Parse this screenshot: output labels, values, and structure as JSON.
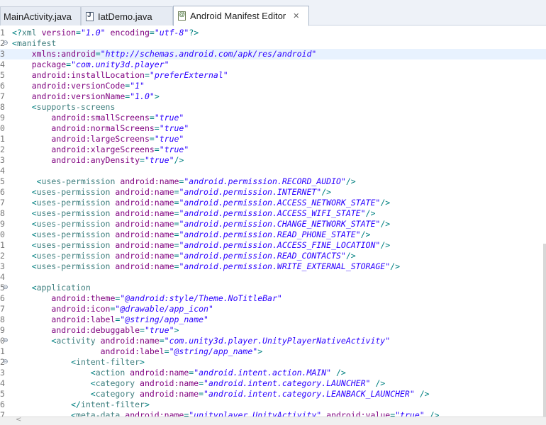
{
  "tabs": [
    {
      "label": "MainActivity.java",
      "icon": "java-file-icon",
      "active": false
    },
    {
      "label": "IatDemo.java",
      "icon": "java-file-icon",
      "active": false
    },
    {
      "label": "Android Manifest Editor",
      "icon": "xml-file-icon",
      "active": true
    }
  ],
  "editor": {
    "highlighted_line": 3,
    "lines": [
      {
        "num": "1",
        "fold": "",
        "segs": [
          [
            "punct",
            "<?"
          ],
          [
            "tag",
            "xml "
          ],
          [
            "attr",
            "version"
          ],
          [
            "punct",
            "="
          ],
          [
            "val",
            "\"1.0\""
          ],
          [
            "punct",
            " "
          ],
          [
            "attr",
            "encoding"
          ],
          [
            "punct",
            "="
          ],
          [
            "val",
            "\"utf-8\""
          ],
          [
            "punct",
            "?>"
          ]
        ]
      },
      {
        "num": "2",
        "fold": "⊖",
        "segs": [
          [
            "punct",
            "<"
          ],
          [
            "tag",
            "manifest"
          ]
        ]
      },
      {
        "num": "3",
        "fold": "",
        "segs": [
          [
            "punct",
            "    "
          ],
          [
            "attr",
            "xmlns:android"
          ],
          [
            "punct",
            "="
          ],
          [
            "val",
            "\"http://schemas.android.com/apk/res/android\""
          ]
        ]
      },
      {
        "num": "4",
        "fold": "",
        "segs": [
          [
            "punct",
            "    "
          ],
          [
            "attr",
            "package"
          ],
          [
            "punct",
            "="
          ],
          [
            "val",
            "\"com.unity3d.player\""
          ]
        ]
      },
      {
        "num": "5",
        "fold": "",
        "segs": [
          [
            "punct",
            "    "
          ],
          [
            "attr",
            "android:installLocation"
          ],
          [
            "punct",
            "="
          ],
          [
            "val",
            "\"preferExternal\""
          ]
        ]
      },
      {
        "num": "6",
        "fold": "",
        "segs": [
          [
            "punct",
            "    "
          ],
          [
            "attr",
            "android:versionCode"
          ],
          [
            "punct",
            "="
          ],
          [
            "val",
            "\"1\""
          ]
        ]
      },
      {
        "num": "7",
        "fold": "",
        "segs": [
          [
            "punct",
            "    "
          ],
          [
            "attr",
            "android:versionName"
          ],
          [
            "punct",
            "="
          ],
          [
            "val",
            "\"1.0\""
          ],
          [
            "punct",
            ">"
          ]
        ]
      },
      {
        "num": "8",
        "fold": "",
        "segs": [
          [
            "punct",
            "    <"
          ],
          [
            "tag",
            "supports-screens"
          ]
        ]
      },
      {
        "num": "9",
        "fold": "",
        "segs": [
          [
            "punct",
            "        "
          ],
          [
            "attr",
            "android:smallScreens"
          ],
          [
            "punct",
            "="
          ],
          [
            "val",
            "\"true\""
          ]
        ]
      },
      {
        "num": "0",
        "fold": "",
        "segs": [
          [
            "punct",
            "        "
          ],
          [
            "attr",
            "android:normalScreens"
          ],
          [
            "punct",
            "="
          ],
          [
            "val",
            "\"true\""
          ]
        ]
      },
      {
        "num": "1",
        "fold": "",
        "segs": [
          [
            "punct",
            "        "
          ],
          [
            "attr",
            "android:largeScreens"
          ],
          [
            "punct",
            "="
          ],
          [
            "val",
            "\"true\""
          ]
        ]
      },
      {
        "num": "2",
        "fold": "",
        "segs": [
          [
            "punct",
            "        "
          ],
          [
            "attr",
            "android:xlargeScreens"
          ],
          [
            "punct",
            "="
          ],
          [
            "val",
            "\"true\""
          ]
        ]
      },
      {
        "num": "3",
        "fold": "",
        "segs": [
          [
            "punct",
            "        "
          ],
          [
            "attr",
            "android:anyDensity"
          ],
          [
            "punct",
            "="
          ],
          [
            "val",
            "\"true\""
          ],
          [
            "punct",
            "/>"
          ]
        ]
      },
      {
        "num": "4",
        "fold": "",
        "segs": []
      },
      {
        "num": "5",
        "fold": "",
        "segs": [
          [
            "punct",
            "     <"
          ],
          [
            "tag",
            "uses-permission "
          ],
          [
            "attr",
            "android:name"
          ],
          [
            "punct",
            "="
          ],
          [
            "val",
            "\"android.permission.RECORD_AUDIO\""
          ],
          [
            "punct",
            "/>"
          ]
        ]
      },
      {
        "num": "6",
        "fold": "",
        "segs": [
          [
            "punct",
            "    <"
          ],
          [
            "tag",
            "uses-permission "
          ],
          [
            "attr",
            "android:name"
          ],
          [
            "punct",
            "="
          ],
          [
            "val",
            "\"android.permission.INTERNET\""
          ],
          [
            "punct",
            "/>"
          ]
        ]
      },
      {
        "num": "7",
        "fold": "",
        "segs": [
          [
            "punct",
            "    <"
          ],
          [
            "tag",
            "uses-permission "
          ],
          [
            "attr",
            "android:name"
          ],
          [
            "punct",
            "="
          ],
          [
            "val",
            "\"android.permission.ACCESS_NETWORK_STATE\""
          ],
          [
            "punct",
            "/>"
          ]
        ]
      },
      {
        "num": "8",
        "fold": "",
        "segs": [
          [
            "punct",
            "    <"
          ],
          [
            "tag",
            "uses-permission "
          ],
          [
            "attr",
            "android:name"
          ],
          [
            "punct",
            "="
          ],
          [
            "val",
            "\"android.permission.ACCESS_WIFI_STATE\""
          ],
          [
            "punct",
            "/>"
          ]
        ]
      },
      {
        "num": "9",
        "fold": "",
        "segs": [
          [
            "punct",
            "    <"
          ],
          [
            "tag",
            "uses-permission "
          ],
          [
            "attr",
            "android:name"
          ],
          [
            "punct",
            "="
          ],
          [
            "val",
            "\"android.permission.CHANGE_NETWORK_STATE\""
          ],
          [
            "punct",
            "/>"
          ]
        ]
      },
      {
        "num": "0",
        "fold": "",
        "segs": [
          [
            "punct",
            "    <"
          ],
          [
            "tag",
            "uses-permission "
          ],
          [
            "attr",
            "android:name"
          ],
          [
            "punct",
            "="
          ],
          [
            "val",
            "\"android.permission.READ_PHONE_STATE\""
          ],
          [
            "punct",
            "/>"
          ]
        ]
      },
      {
        "num": "1",
        "fold": "",
        "segs": [
          [
            "punct",
            "    <"
          ],
          [
            "tag",
            "uses-permission "
          ],
          [
            "attr",
            "android:name"
          ],
          [
            "punct",
            "="
          ],
          [
            "val",
            "\"android.permission.ACCESS_FINE_LOCATION\""
          ],
          [
            "punct",
            "/>"
          ]
        ]
      },
      {
        "num": "2",
        "fold": "",
        "segs": [
          [
            "punct",
            "    <"
          ],
          [
            "tag",
            "uses-permission "
          ],
          [
            "attr",
            "android:name"
          ],
          [
            "punct",
            "="
          ],
          [
            "val",
            "\"android.permission.READ_CONTACTS\""
          ],
          [
            "punct",
            "/>"
          ]
        ]
      },
      {
        "num": "3",
        "fold": "",
        "segs": [
          [
            "punct",
            "    <"
          ],
          [
            "tag",
            "uses-permission "
          ],
          [
            "attr",
            "android:name"
          ],
          [
            "punct",
            "="
          ],
          [
            "val",
            "\"android.permission.WRITE_EXTERNAL_STORAGE\""
          ],
          [
            "punct",
            "/>"
          ]
        ]
      },
      {
        "num": "4",
        "fold": "",
        "segs": []
      },
      {
        "num": "5",
        "fold": "⊖",
        "segs": [
          [
            "punct",
            "    <"
          ],
          [
            "tag",
            "application"
          ]
        ]
      },
      {
        "num": "6",
        "fold": "",
        "segs": [
          [
            "punct",
            "        "
          ],
          [
            "attr",
            "android:theme"
          ],
          [
            "punct",
            "="
          ],
          [
            "val",
            "\"@android:style/Theme.NoTitleBar\""
          ]
        ]
      },
      {
        "num": "7",
        "fold": "",
        "segs": [
          [
            "punct",
            "        "
          ],
          [
            "attr",
            "android:icon"
          ],
          [
            "punct",
            "="
          ],
          [
            "val",
            "\"@drawable/app_icon\""
          ]
        ]
      },
      {
        "num": "8",
        "fold": "",
        "segs": [
          [
            "punct",
            "        "
          ],
          [
            "attr",
            "android:label"
          ],
          [
            "punct",
            "="
          ],
          [
            "val",
            "\"@string/app_name\""
          ]
        ]
      },
      {
        "num": "9",
        "fold": "",
        "segs": [
          [
            "punct",
            "        "
          ],
          [
            "attr",
            "android:debuggable"
          ],
          [
            "punct",
            "="
          ],
          [
            "val",
            "\"true\""
          ],
          [
            "punct",
            ">"
          ]
        ]
      },
      {
        "num": "0",
        "fold": "⊖",
        "segs": [
          [
            "punct",
            "        <"
          ],
          [
            "tag",
            "activity "
          ],
          [
            "attr",
            "android:name"
          ],
          [
            "punct",
            "="
          ],
          [
            "val",
            "\"com.unity3d.player.UnityPlayerNativeActivity\""
          ]
        ]
      },
      {
        "num": "1",
        "fold": "",
        "segs": [
          [
            "punct",
            "                  "
          ],
          [
            "attr",
            "android:label"
          ],
          [
            "punct",
            "="
          ],
          [
            "val",
            "\"@string/app_name\""
          ],
          [
            "punct",
            ">"
          ]
        ]
      },
      {
        "num": "2",
        "fold": "⊖",
        "segs": [
          [
            "punct",
            "            <"
          ],
          [
            "tag",
            "intent-filter"
          ],
          [
            "punct",
            ">"
          ]
        ]
      },
      {
        "num": "3",
        "fold": "",
        "segs": [
          [
            "punct",
            "                <"
          ],
          [
            "tag",
            "action "
          ],
          [
            "attr",
            "android:name"
          ],
          [
            "punct",
            "="
          ],
          [
            "val",
            "\"android.intent.action.MAIN\""
          ],
          [
            "punct",
            " />"
          ]
        ]
      },
      {
        "num": "4",
        "fold": "",
        "segs": [
          [
            "punct",
            "                <"
          ],
          [
            "tag",
            "category "
          ],
          [
            "attr",
            "android:name"
          ],
          [
            "punct",
            "="
          ],
          [
            "val",
            "\"android.intent.category.LAUNCHER\""
          ],
          [
            "punct",
            " />"
          ]
        ]
      },
      {
        "num": "5",
        "fold": "",
        "segs": [
          [
            "punct",
            "                <"
          ],
          [
            "tag",
            "category "
          ],
          [
            "attr",
            "android:name"
          ],
          [
            "punct",
            "="
          ],
          [
            "val",
            "\"android.intent.category.LEANBACK_LAUNCHER\""
          ],
          [
            "punct",
            " />"
          ]
        ]
      },
      {
        "num": "6",
        "fold": "",
        "segs": [
          [
            "punct",
            "            </"
          ],
          [
            "tag",
            "intent-filter"
          ],
          [
            "punct",
            ">"
          ]
        ]
      },
      {
        "num": "7",
        "fold": "",
        "segs": [
          [
            "punct",
            "            <"
          ],
          [
            "tag",
            "meta-data "
          ],
          [
            "attr",
            "android:name"
          ],
          [
            "punct",
            "="
          ],
          [
            "val",
            "\"unityplayer.UnityActivity\""
          ],
          [
            "punct",
            " "
          ],
          [
            "attr",
            "android:value"
          ],
          [
            "punct",
            "="
          ],
          [
            "val",
            "\"true\""
          ],
          [
            "punct",
            " />"
          ]
        ]
      }
    ]
  },
  "scrollbar": {
    "left_arrow": "<"
  }
}
